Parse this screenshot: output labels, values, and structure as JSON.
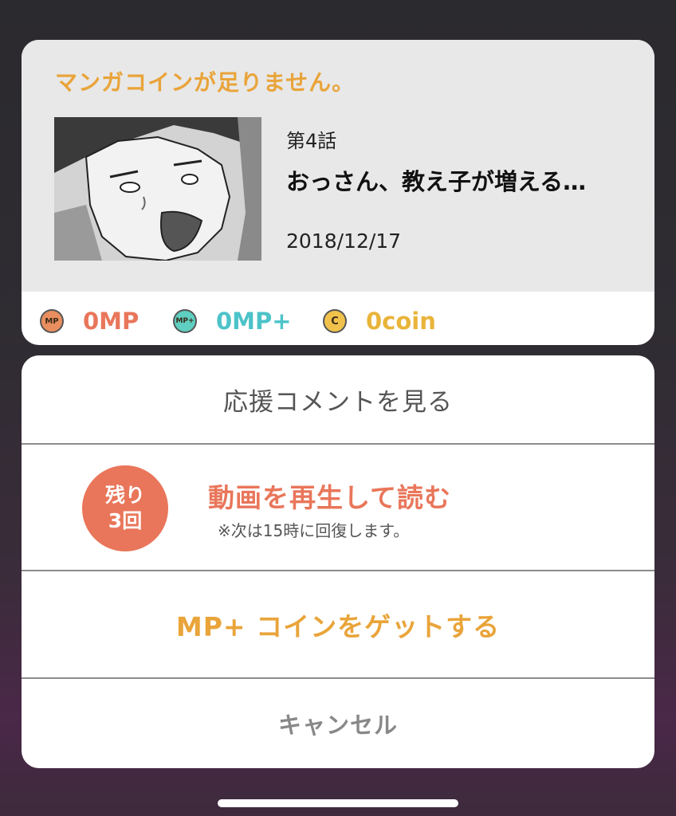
{
  "info_card": {
    "title": "マンガコインが足りません。",
    "episode_number": "第4話",
    "episode_title": "おっさん、教え子が増える…",
    "release_date": "2018/12/17"
  },
  "balances": [
    {
      "icon": "mp-coin-icon",
      "badge": "MP",
      "value": "0MP",
      "color": "#e9765a",
      "coin_fill": "#e98e5e"
    },
    {
      "icon": "mp-plus-coin-icon",
      "badge": "MP+",
      "value": "0MP+",
      "color": "#4cc3c9",
      "coin_fill": "#5ecfc0"
    },
    {
      "icon": "coin-icon",
      "badge": "C",
      "value": "0coin",
      "color": "#e9b43a",
      "coin_fill": "#f1c24b"
    }
  ],
  "actions": {
    "comments_label": "応援コメントを見る",
    "video": {
      "badge_line1": "残り",
      "badge_line2": "3回",
      "label": "動画を再生して読む",
      "note": "※次は15時に回復します。"
    },
    "get_coins_label": "MP+ コインをゲットする",
    "cancel_label": "キャンセル"
  },
  "colors": {
    "accent_orange": "#e9a43a",
    "accent_salmon": "#e9765a",
    "accent_teal": "#4cc3c9"
  }
}
